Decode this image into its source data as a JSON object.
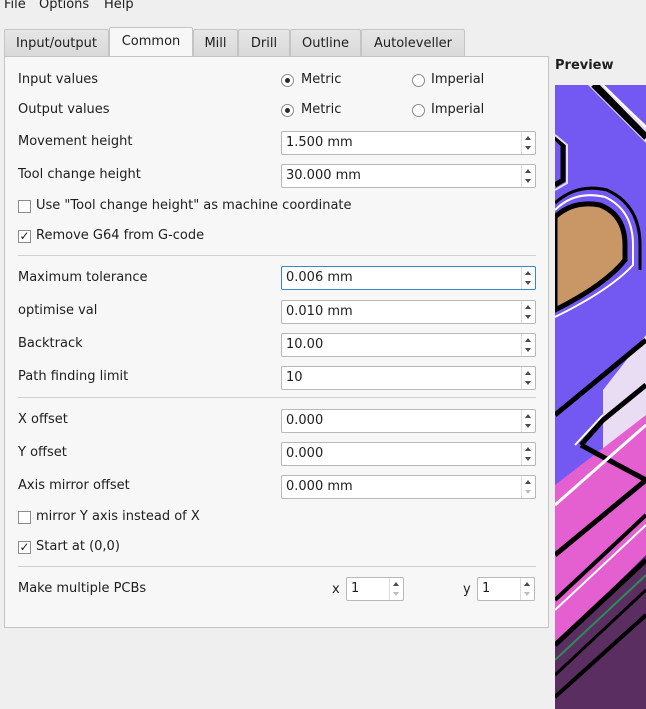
{
  "menubar": {
    "items": [
      "File",
      "Options",
      "Help"
    ]
  },
  "tabs": [
    "Input/output",
    "Common",
    "Mill",
    "Drill",
    "Outline",
    "Autoleveller"
  ],
  "active_tab": "Common",
  "form": {
    "input_values": {
      "label": "Input values",
      "options": [
        "Metric",
        "Imperial"
      ],
      "selected": "Metric"
    },
    "output_values": {
      "label": "Output values",
      "options": [
        "Metric",
        "Imperial"
      ],
      "selected": "Metric"
    },
    "movement_height": {
      "label": "Movement height",
      "value": "1.500 mm"
    },
    "tool_change_height": {
      "label": "Tool change height",
      "value": "30.000 mm"
    },
    "tool_change_machine_coord": {
      "label": "Use \"Tool change height\" as machine coordinate",
      "checked": false
    },
    "remove_g64": {
      "label": "Remove G64 from G-code",
      "checked": true
    },
    "maximum_tolerance": {
      "label": "Maximum tolerance",
      "value": "0.006 mm"
    },
    "optimise_val": {
      "label": "optimise val",
      "value": "0.010 mm"
    },
    "backtrack": {
      "label": "Backtrack",
      "value": "10.00"
    },
    "path_finding_limit": {
      "label": "Path finding limit",
      "value": "10"
    },
    "x_offset": {
      "label": "X offset",
      "value": "0.000"
    },
    "y_offset": {
      "label": "Y offset",
      "value": "0.000"
    },
    "axis_mirror_offset": {
      "label": "Axis mirror offset",
      "value": "0.000 mm"
    },
    "mirror_y_axis": {
      "label": "mirror Y axis instead of X",
      "checked": false
    },
    "start_at_origin": {
      "label": "Start at (0,0)",
      "checked": true
    },
    "multiple_pcbs": {
      "label": "Make multiple PCBs",
      "x_label": "x",
      "x_value": "1",
      "y_label": "y",
      "y_value": "1"
    }
  },
  "preview": {
    "title": "Preview",
    "colors": {
      "purple": "#7458f2",
      "magenta": "#e45fcf",
      "copper": "#c99766",
      "dark_purple": "#5a2e60",
      "trace_black": "#000000",
      "border_light": "#e8ddf2"
    }
  },
  "colors": {
    "focus_border": "#3a84c8",
    "panel_bg": "#f7f7f7",
    "window_bg": "#efefef"
  }
}
